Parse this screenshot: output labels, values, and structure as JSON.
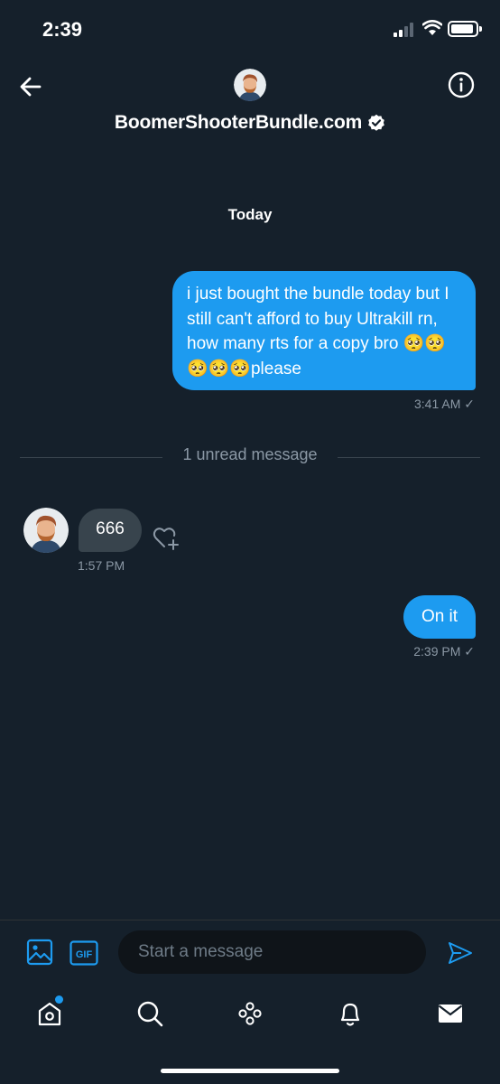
{
  "status_bar": {
    "time": "2:39"
  },
  "header": {
    "name": "BoomerShooterBundle.com",
    "verified": true
  },
  "conversation": {
    "date_separator": "Today",
    "messages": [
      {
        "direction": "outgoing",
        "text": "i just bought the bundle today but I still can't afford to buy Ultrakill rn, how many rts for a copy bro 🥺🥺🥺🥺🥺please",
        "time": "3:41 AM ✓"
      },
      {
        "direction": "incoming",
        "text": "666",
        "time": "1:57 PM"
      },
      {
        "direction": "outgoing",
        "text": "On it",
        "time": "2:39 PM ✓"
      }
    ],
    "unread_label": "1 unread message"
  },
  "composer": {
    "placeholder": "Start a message",
    "gif_label": "GIF"
  },
  "tabs": [
    "home-icon",
    "search-icon",
    "spaces-icon",
    "notifications-icon",
    "messages-icon"
  ],
  "colors": {
    "background": "#15202b",
    "accent": "#1d9bf0",
    "incoming_bubble": "#38444d",
    "muted_text": "#8b98a5"
  }
}
